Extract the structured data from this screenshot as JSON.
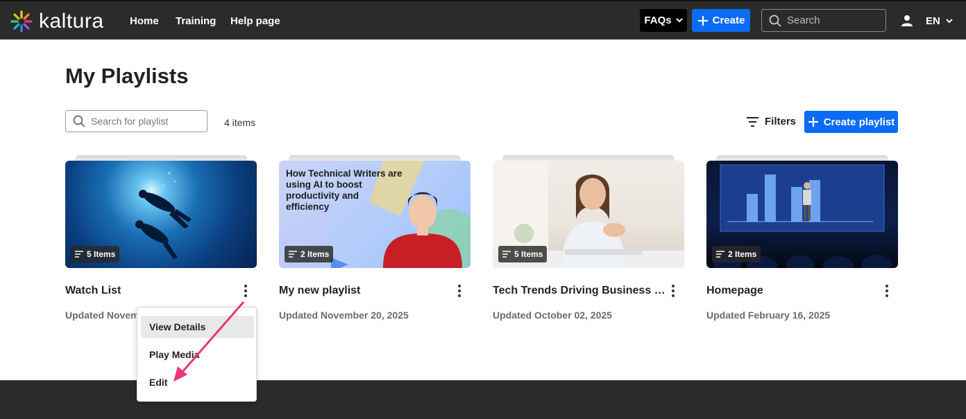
{
  "header": {
    "logo_text": "kaltura",
    "nav": [
      {
        "label": "Home"
      },
      {
        "label": "Training"
      },
      {
        "label": "Help page"
      }
    ],
    "faqs_label": "FAQs",
    "create_label": "Create",
    "search_placeholder": "Search",
    "language": "EN"
  },
  "main": {
    "title": "My Playlists",
    "search_placeholder": "Search for playlist",
    "item_count": "4 items",
    "filters_label": "Filters",
    "create_playlist_label": "Create playlist"
  },
  "playlists": [
    {
      "title": "Watch List",
      "updated": "Updated November 20, 2025",
      "items_badge": "5 Items"
    },
    {
      "title": "My new playlist",
      "updated": "Updated November 20, 2025",
      "items_badge": "2 Items",
      "thumb_text": "How Technical Writers are using AI to boost productivity and efficiency"
    },
    {
      "title": "Tech Trends Driving Business I...",
      "updated": "Updated October 02, 2025",
      "items_badge": "5 Items"
    },
    {
      "title": "Homepage",
      "updated": "Updated February 16, 2025",
      "items_badge": "2 Items"
    }
  ],
  "context_menu": {
    "items": [
      {
        "label": "View Details",
        "state": "hover"
      },
      {
        "label": "Play Media"
      },
      {
        "label": "Edit"
      }
    ]
  },
  "colors": {
    "header_bg": "#2b2b2b",
    "accent_blue": "#0a6cf5",
    "annotation_arrow": "#e8367a"
  },
  "icons": [
    "kaltura-logo-icon",
    "chevron-down-icon",
    "plus-icon",
    "search-icon",
    "user-icon",
    "filter-icon",
    "playlist-icon",
    "kebab-menu-icon"
  ]
}
